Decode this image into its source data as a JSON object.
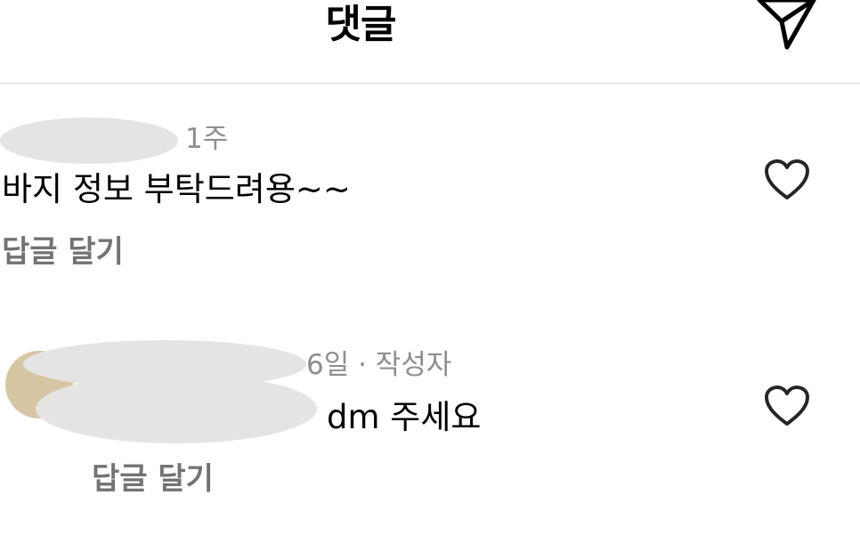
{
  "header": {
    "title": "댓글",
    "send_icon": "paper-plane-icon"
  },
  "comments": [
    {
      "time": "1주",
      "text": "바지 정보 부탁드려용~~",
      "reply_label": "답글 달기",
      "like_icon": "heart-outline-icon"
    },
    {
      "time_author": "6일 · 작성자",
      "text": "dm 주세요",
      "reply_label": "답글 달기",
      "like_icon": "heart-outline-icon"
    }
  ]
}
